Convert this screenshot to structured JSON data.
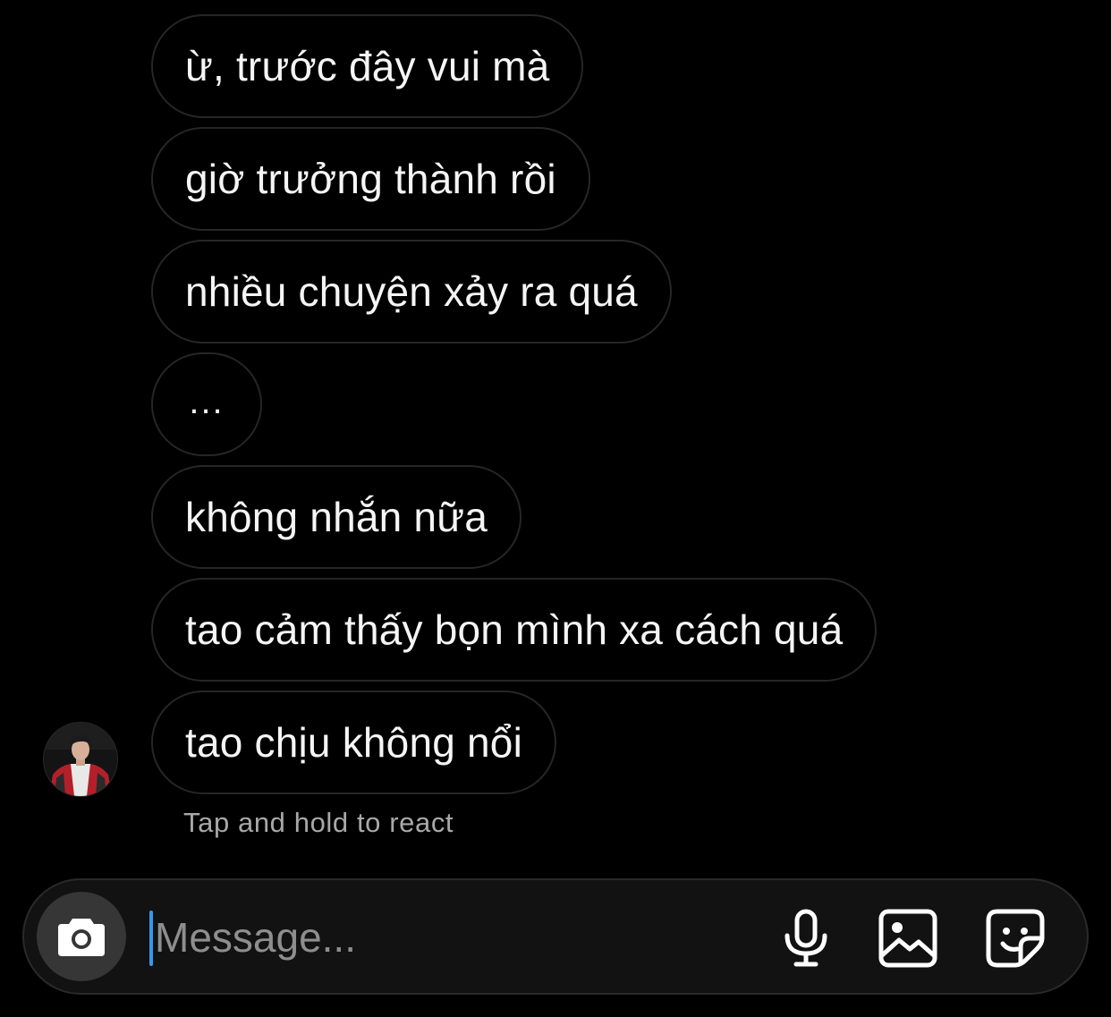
{
  "messages": [
    {
      "text": "ừ, trước đây vui mà"
    },
    {
      "text": "giờ trưởng thành rồi"
    },
    {
      "text": "nhiều chuyện xảy ra quá"
    },
    {
      "text": "..."
    },
    {
      "text": "không nhắn nữa"
    },
    {
      "text": "tao cảm thấy bọn mình xa cách quá"
    },
    {
      "text": "tao chịu không nổi"
    }
  ],
  "hint": "Tap and hold to react",
  "composer": {
    "placeholder": "Message...",
    "value": ""
  },
  "icons": {
    "camera": "camera-icon",
    "microphone": "microphone-icon",
    "gallery": "gallery-icon",
    "sticker": "sticker-icon"
  },
  "colors": {
    "background": "#000000",
    "bubble_border": "#262626",
    "caret": "#3897f0",
    "hint": "#a8a8a8",
    "placeholder": "#8e8e8e"
  }
}
